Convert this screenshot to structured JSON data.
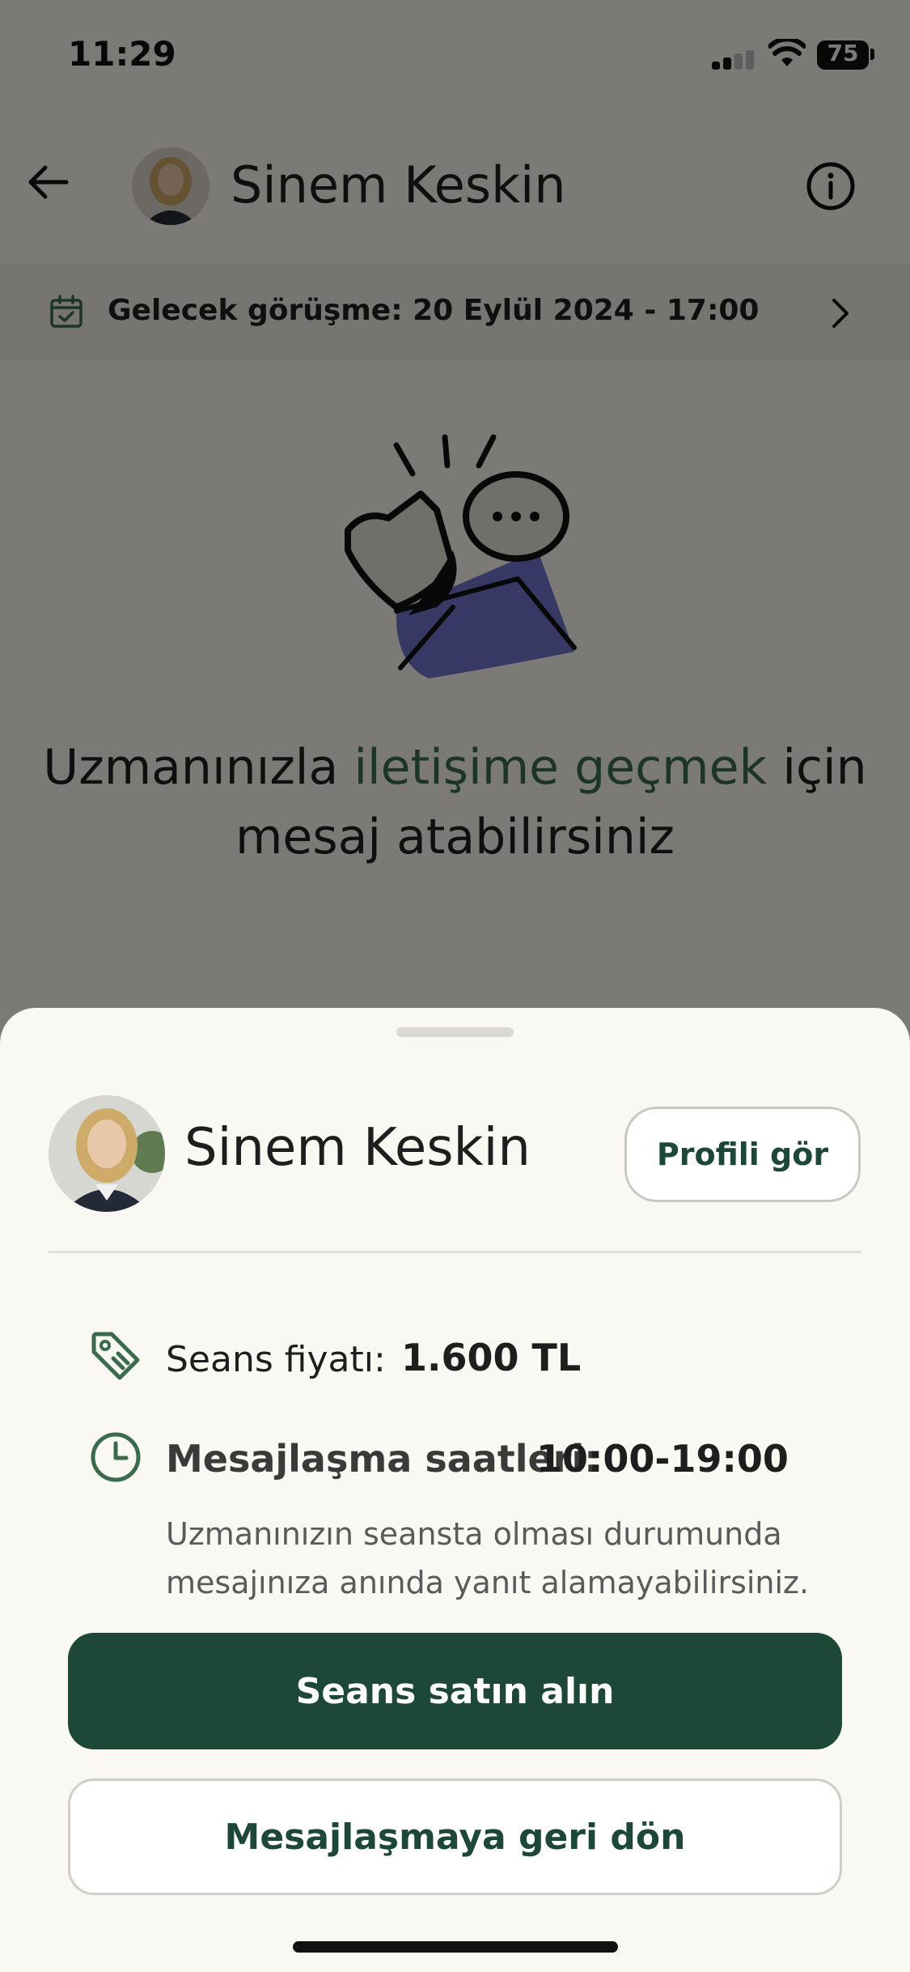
{
  "status_bar": {
    "time": "11:29",
    "battery": "75"
  },
  "header": {
    "name": "Sinem Keskin"
  },
  "next_meeting": {
    "text": "Gelecek görüşme: 20 Eylül 2024 - 17:00"
  },
  "empty_state": {
    "line1_before": "Uzmanınızla ",
    "line1_accent": "iletişime geçmek",
    "line1_after": " için",
    "line2": "mesaj atabilirsiniz"
  },
  "sheet": {
    "name": "Sinem Keskin",
    "profile_button": "Profili gör",
    "price_label": "Seans fiyatı:",
    "price_value": "1.600 TL",
    "hours_label": "Mesajlaşma saatleri:",
    "hours_value": "10:00-19:00",
    "hours_note": "Uzmanınızın seansta olması durumunda mesajınıza anında yanıt alamayabilirsiniz.",
    "buy_button": "Seans satın alın",
    "back_button": "Mesajlaşmaya geri dön"
  },
  "colors": {
    "brand": "#1d4736",
    "accent": "#3a6b4d",
    "sheet_bg": "#f9f8f2"
  },
  "icons": [
    "back-arrow-icon",
    "info-icon",
    "calendar-icon",
    "chevron-right-icon",
    "price-tag-icon",
    "clock-icon"
  ]
}
